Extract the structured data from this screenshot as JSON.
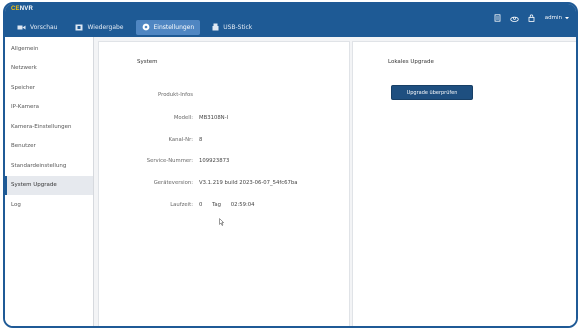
{
  "app": {
    "logo_mark": "CE",
    "logo_text": "NVR"
  },
  "tabs": [
    {
      "label": "Vorschau",
      "icon": "camera-icon",
      "active": false
    },
    {
      "label": "Wiedergabe",
      "icon": "film-icon",
      "active": false
    },
    {
      "label": "Einstellungen",
      "icon": "gear-icon",
      "active": true
    },
    {
      "label": "USB-Stick",
      "icon": "usb-icon",
      "active": false
    }
  ],
  "header_right": {
    "user": "admin"
  },
  "sidebar": {
    "items": [
      {
        "label": "Allgemein"
      },
      {
        "label": "Netzwerk"
      },
      {
        "label": "Speicher"
      },
      {
        "label": "IP-Kamera"
      },
      {
        "label": "Kamera-Einstellungen"
      },
      {
        "label": "Benutzer"
      },
      {
        "label": "Standardeinstellung"
      },
      {
        "label": "System Upgrade",
        "active": true
      },
      {
        "label": "Log"
      }
    ]
  },
  "system_panel": {
    "title": "System",
    "product_info_label": "Produkt-Infos",
    "model_label": "Modell:",
    "model_value": "MB3108N-I",
    "channels_label": "Kanal-Nr:",
    "channels_value": "8",
    "serial_label": "Service-Nummer:",
    "serial_value": "109923873",
    "version_label": "Geräteversion:",
    "version_value": "V3.1.219 build 2023-06-07_54fc67ba",
    "uptime_label": "Laufzeit:",
    "uptime_days": "0",
    "uptime_unit": "Tag",
    "uptime_time": "02:59:04"
  },
  "upgrade_panel": {
    "title": "Lokales Upgrade",
    "button_label": "Upgrade überprüfen"
  },
  "colors": {
    "header": "#1e5a95",
    "active_tab": "#4f86c2",
    "button": "#1e4f80",
    "logo_accent": "#f4c20d"
  }
}
